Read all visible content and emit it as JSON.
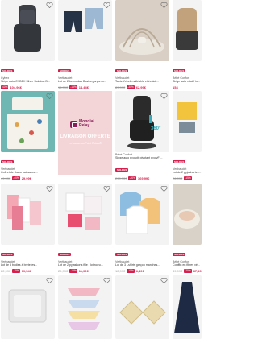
{
  "products": [
    {
      "id": "p1",
      "badge": "SOLDES",
      "brand": "Cybex",
      "title": "Siège auto CYBEX Silver Solution B...",
      "old": "",
      "disc": "-40%",
      "new": "104,96€",
      "colors": {
        "bg": "#f3f3f3",
        "main": "#3b3e44"
      }
    },
    {
      "id": "p2",
      "badge": "SOLDES",
      "brand": "Vertbaudet",
      "title": "Lot de 2 bermudas Basics garçon a...",
      "old": "16,99€",
      "disc": "-15%",
      "new": "14,44€",
      "colors": {
        "bg": "#f3f3f3",
        "main": "#263347",
        "alt": "#9db8d3"
      }
    },
    {
      "id": "p3",
      "badge": "SOLDES",
      "brand": "Vertbaudet",
      "title": "Tapis d'éveil malléable et évoluti...",
      "old": "89,99€",
      "disc": "-30%",
      "new": "62,99€",
      "colors": {
        "bg": "#d9cfc4",
        "main": "#e8e3d8"
      }
    },
    {
      "id": "p4",
      "badge": "SOLDES",
      "brand": "Bébé Confort",
      "title": "Siège auto rotatif isofix gr...",
      "old": "",
      "disc": "",
      "new": "154",
      "colors": {
        "bg": "#f3f3f3",
        "main": "#c2a27c"
      }
    },
    {
      "id": "p5",
      "badge": "SOLDES",
      "brand": "Vertbaudet",
      "title": "Coffret de draps naissance...",
      "old": "49,99€",
      "disc": "-40%",
      "new": "29,99€",
      "colors": {
        "bg": "#6fb7b3",
        "main": "#f5f2ec"
      }
    },
    {
      "id": "p6",
      "badge": "SOLDES",
      "brand": "Bébé Confort",
      "title": "Siège auto évolutif pivotant evolvFi...",
      "old": "299,90€",
      "disc": "-20%",
      "new": "169,99€",
      "colors": {
        "bg": "#f3f3f3",
        "main": "#2b2b2b"
      }
    },
    {
      "id": "p7",
      "badge": "SOLDES",
      "brand": "Vertbaudet",
      "title": "Lot de 2 pyjashorts t...",
      "old": "26,99€",
      "disc": "-15%",
      "new": "",
      "colors": {
        "bg": "#f3f3f3",
        "main": "#f2c43d"
      }
    },
    {
      "id": "p8",
      "badge": "SOLDES",
      "brand": "Vertbaudet",
      "title": "Lot de 5 bodies à bretelles...",
      "old": "22,99€",
      "disc": "-15%",
      "new": "19,54€",
      "colors": {
        "bg": "#f3f3f3",
        "main": "#f4a8b4"
      }
    },
    {
      "id": "p9",
      "badge": "SOLDES",
      "brand": "Vertbaudet",
      "title": "Lot de 2 pyjashorts fille - lot noeu...",
      "old": "29,99€",
      "disc": "-15%",
      "new": "11,99€",
      "colors": {
        "bg": "#f3f3f3",
        "main": "#e84d6f"
      }
    },
    {
      "id": "p10",
      "badge": "SOLDES",
      "brand": "Vertbaudet",
      "title": "Lot de 3 t-shirts garçon manches...",
      "old": "12,99€",
      "disc": "-15%",
      "new": "6,49€",
      "colors": {
        "bg": "#f3f3f3",
        "main": "#8dbde0",
        "alt": "#f2c27a"
      }
    },
    {
      "id": "p11",
      "badge": "SOLDES",
      "brand": "Bébé Confort",
      "title": "Couffin en fibres végét...",
      "old": "89,99€",
      "disc": "-25%",
      "new": "67,49",
      "colors": {
        "bg": "#d8d2c9",
        "main": "#f0ebe3"
      }
    },
    {
      "id": "p12",
      "badge": "",
      "brand": "",
      "title": "",
      "old": "",
      "disc": "",
      "new": "",
      "colors": {
        "bg": "#f3f3f3",
        "main": "#e7e7e7"
      }
    },
    {
      "id": "p13",
      "badge": "",
      "brand": "",
      "title": "",
      "old": "",
      "disc": "",
      "new": "",
      "colors": {
        "bg": "#f3f3f3",
        "main": "#f2b8c4"
      }
    },
    {
      "id": "p14",
      "badge": "",
      "brand": "",
      "title": "",
      "old": "",
      "disc": "",
      "new": "",
      "colors": {
        "bg": "#f3f3f3",
        "main": "#e9dab0"
      }
    },
    {
      "id": "p15",
      "badge": "",
      "brand": "",
      "title": "",
      "old": "",
      "disc": "",
      "new": "",
      "colors": {
        "bg": "#f3f3f3",
        "main": "#1e2a44"
      }
    }
  ],
  "promo": {
    "brand": "Mondial Relay",
    "line1": "LIVRAISON OFFERTE",
    "line2": "en Locker ou Point Relais®",
    "bg": "#f4d5d7",
    "brand_color": "#8a1e5a"
  },
  "badge_360": "360°",
  "icons": {
    "favorite": "heart-outline-icon"
  }
}
